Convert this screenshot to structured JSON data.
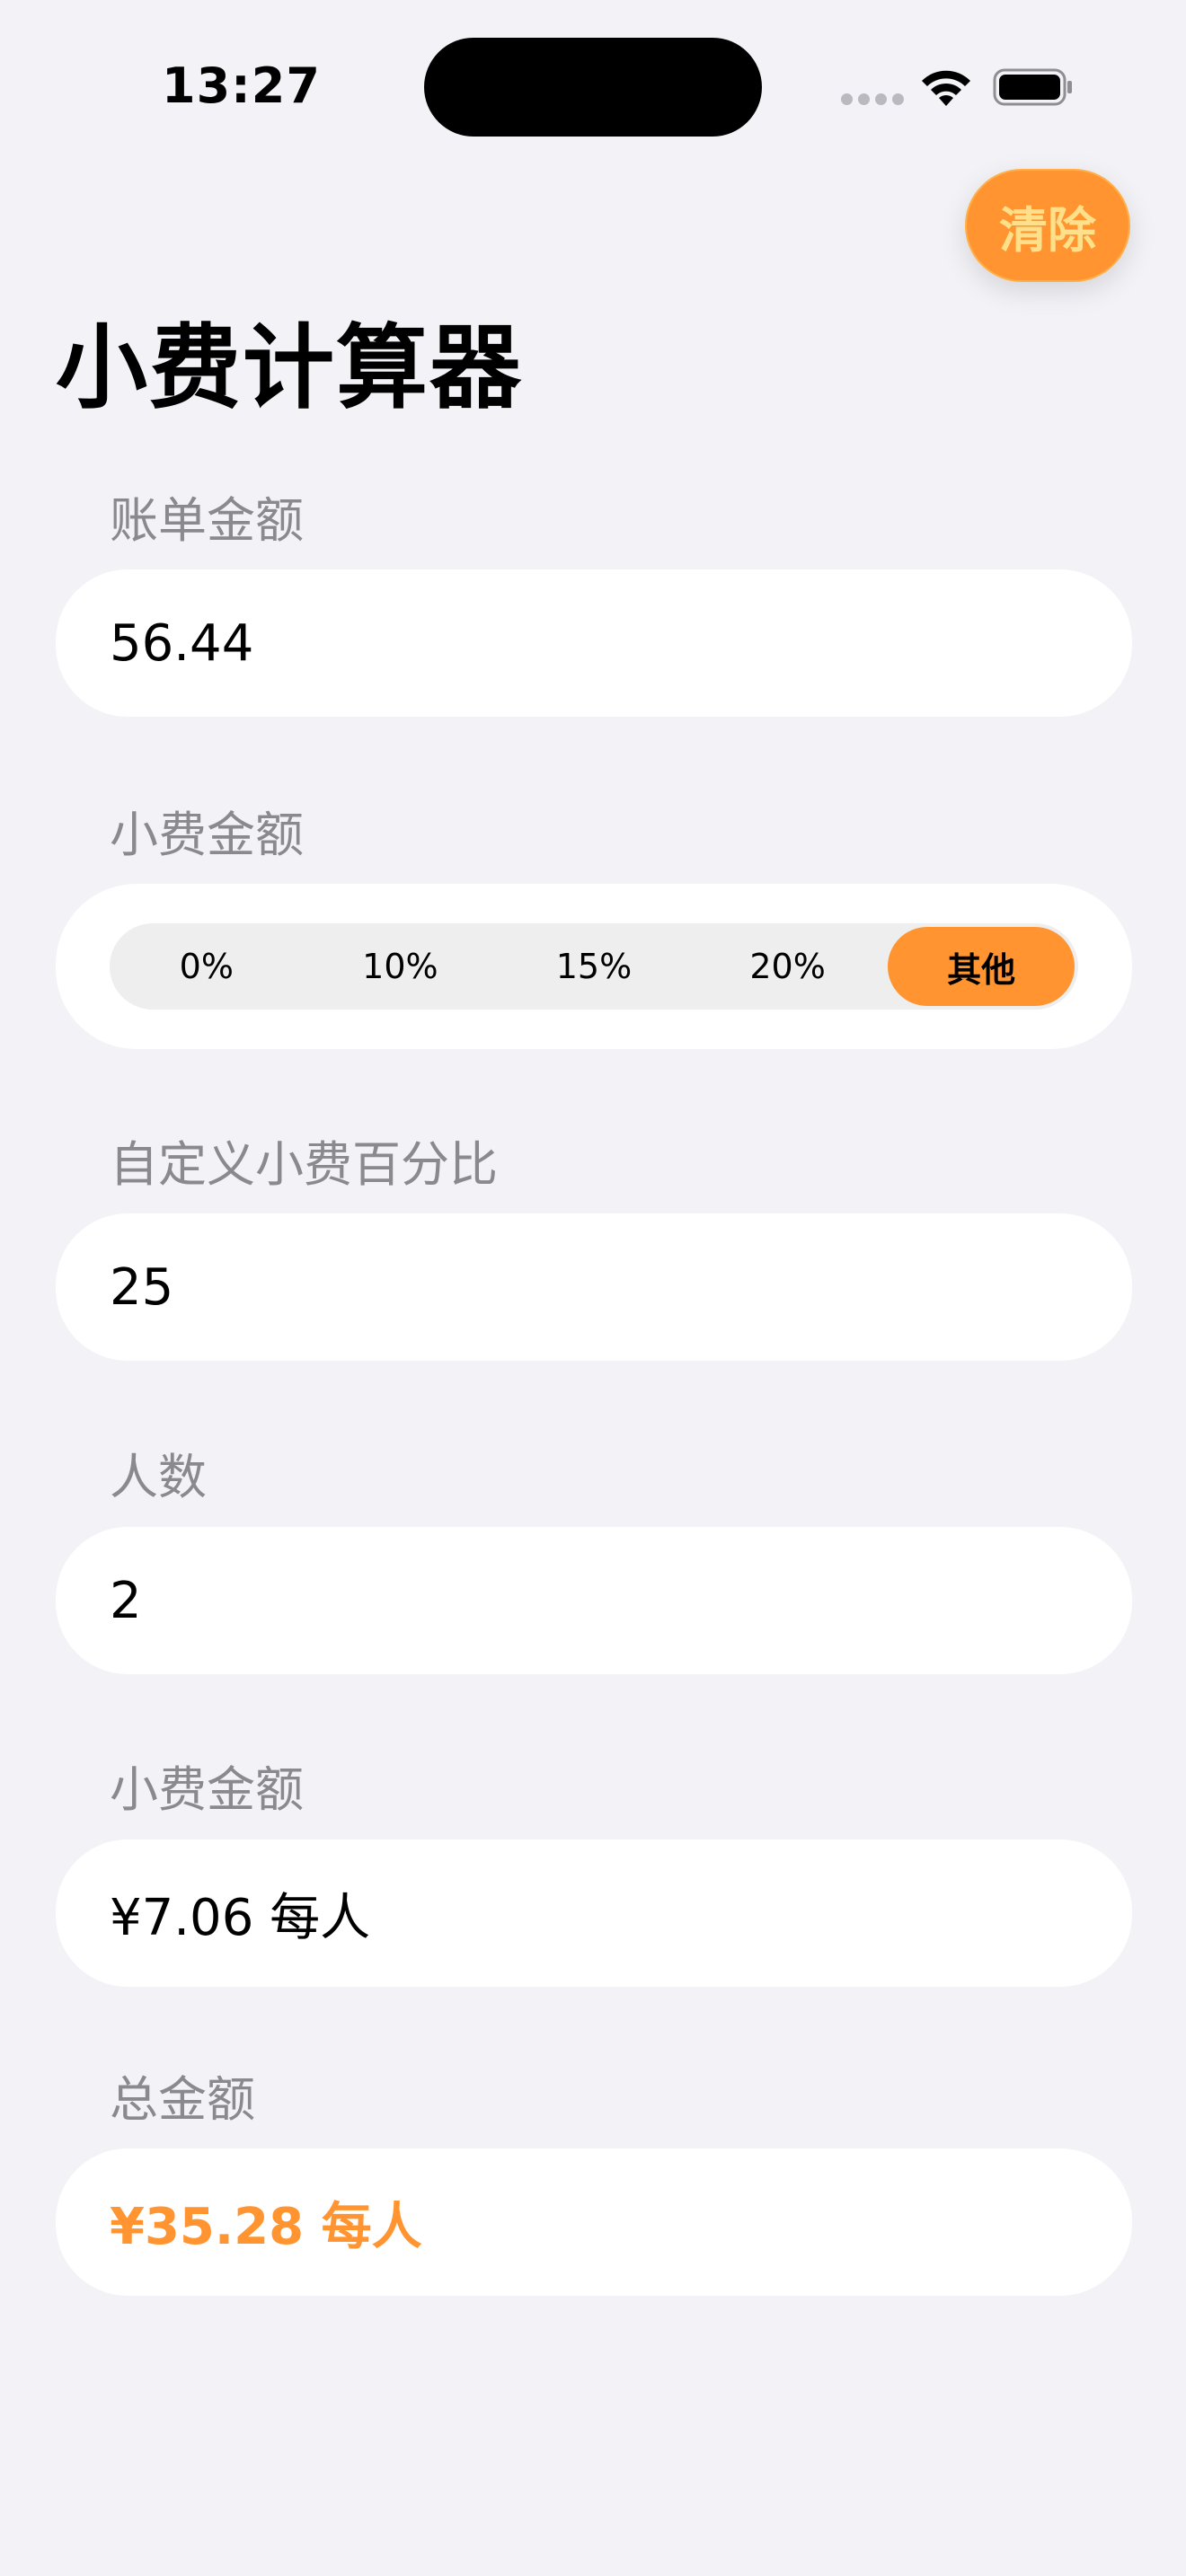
{
  "status_bar": {
    "time": "13:27"
  },
  "header": {
    "clear_label": "清除",
    "title": "小费计算器"
  },
  "bill": {
    "label": "账单金额",
    "value": "56.44"
  },
  "tip": {
    "label": "小费金额",
    "options": [
      "0%",
      "10%",
      "15%",
      "20%",
      "其他"
    ],
    "selected_index": 4
  },
  "custom_tip": {
    "label": "自定义小费百分比",
    "value": "25"
  },
  "people": {
    "label": "人数",
    "value": "2"
  },
  "tip_result": {
    "label": "小费金额",
    "value": "¥7.06 每人"
  },
  "total_result": {
    "label": "总金额",
    "value": "¥35.28 每人"
  },
  "colors": {
    "accent": "#ff9430",
    "background": "#f2f2f7",
    "card": "#ffffff",
    "label": "#8a8a8e"
  },
  "icons": {
    "wifi": "wifi-icon",
    "battery": "battery-icon",
    "signal": "cellular-signal-icon"
  }
}
